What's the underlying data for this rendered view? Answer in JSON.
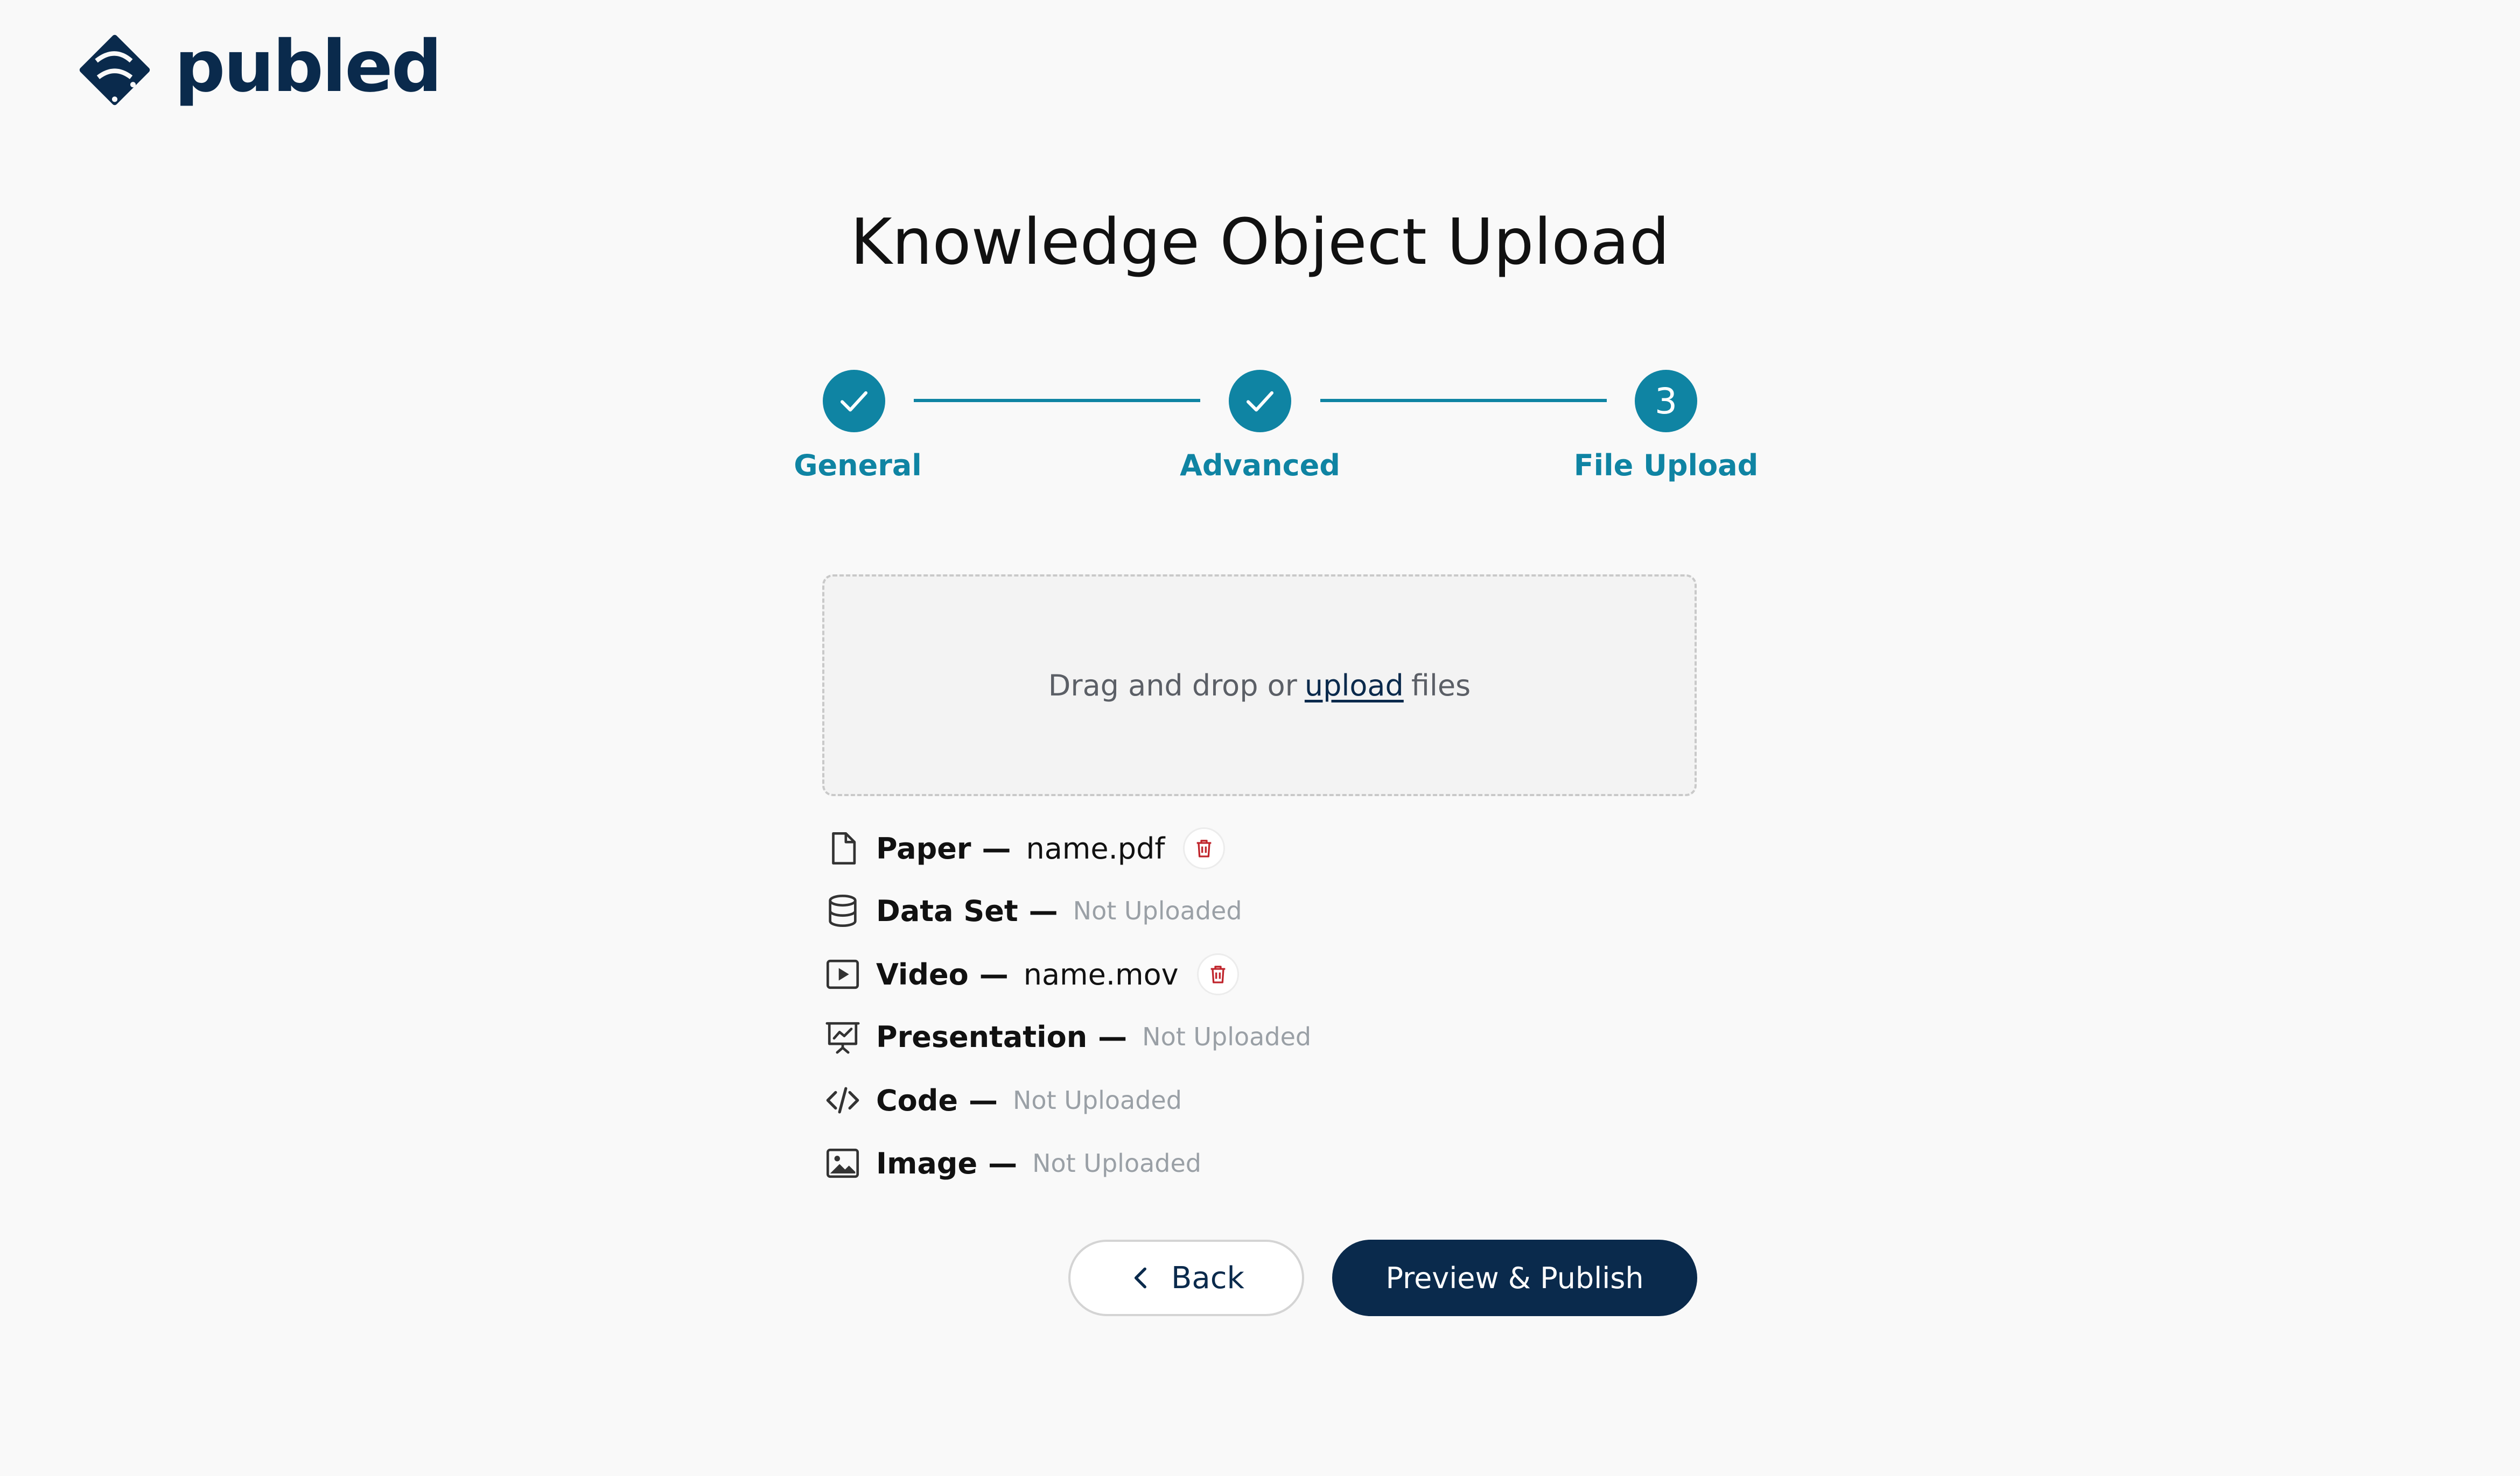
{
  "brand": {
    "logo_text": "publed",
    "color": "#0a2a4c"
  },
  "page": {
    "title": "Knowledge Object Upload"
  },
  "stepper": {
    "accent_color": "#0f84a3",
    "steps": [
      {
        "label": "General",
        "state": "complete",
        "icon": "check-icon"
      },
      {
        "label": "Advanced",
        "state": "complete",
        "icon": "check-icon"
      },
      {
        "label": "File Upload",
        "state": "current",
        "number": "3"
      }
    ]
  },
  "dropzone": {
    "text_before": "Drag and drop or",
    "link_text": "upload",
    "text_after": "files"
  },
  "files": [
    {
      "type": "Paper",
      "icon": "document-icon",
      "value": "name.pdf",
      "uploaded": true
    },
    {
      "type": "Data Set",
      "icon": "database-icon",
      "value": "Not Uploaded",
      "uploaded": false
    },
    {
      "type": "Video",
      "icon": "video-icon",
      "value": "name.mov",
      "uploaded": true
    },
    {
      "type": "Presentation",
      "icon": "presentation-icon",
      "value": "Not Uploaded",
      "uploaded": false
    },
    {
      "type": "Code",
      "icon": "code-icon",
      "value": "Not Uploaded",
      "uploaded": false
    },
    {
      "type": "Image",
      "icon": "image-icon",
      "value": "Not Uploaded",
      "uploaded": false
    }
  ],
  "dash": "—",
  "actions": {
    "back_label": "Back",
    "publish_label": "Preview & Publish"
  },
  "colors": {
    "delete_icon": "#c0262d",
    "muted_text": "#9aa0a6"
  }
}
